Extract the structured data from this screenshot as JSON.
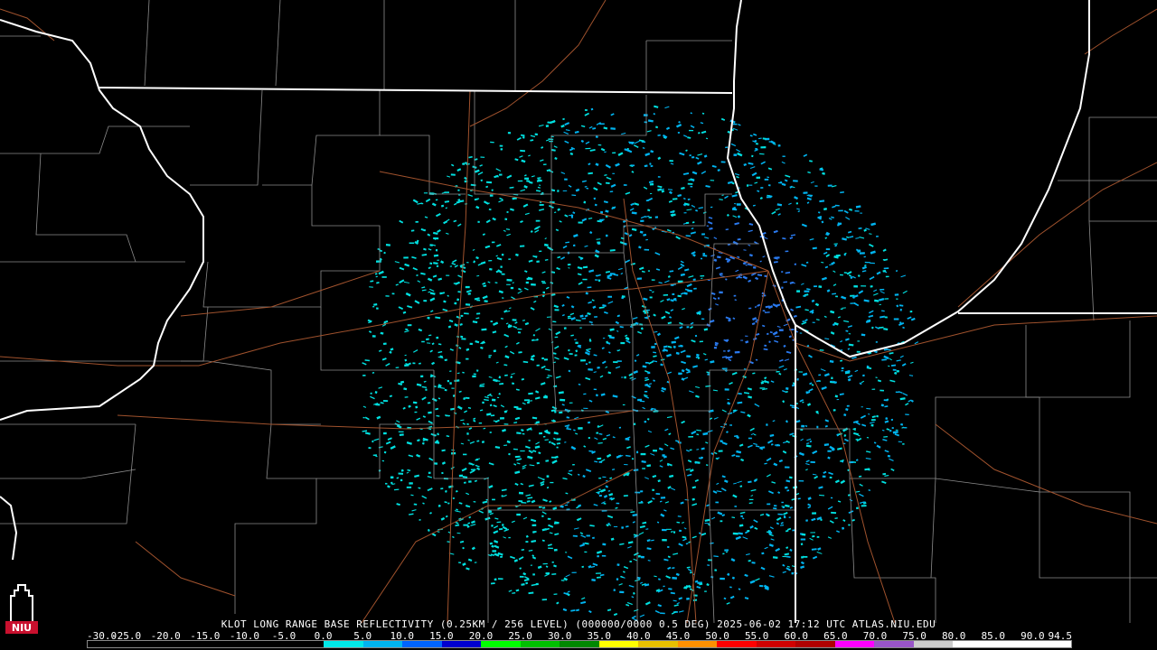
{
  "caption": {
    "product": "KLOT LONG RANGE BASE REFLECTIVITY (0.25KM / 256 LEVEL) (000000/0000 0.5 DEG) 2025-06-02 17:12 UTC  ATLAS.NIU.EDU"
  },
  "color_scale": {
    "labels": [
      "-30.0",
      "-25.0",
      "-20.0",
      "-15.0",
      "-10.0",
      "-5.0",
      "0.0",
      "5.0",
      "10.0",
      "15.0",
      "20.0",
      "25.0",
      "30.0",
      "35.0",
      "40.0",
      "45.0",
      "50.0",
      "55.0",
      "60.0",
      "65.0",
      "70.0",
      "75.0",
      "80.0",
      "85.0",
      "90.0",
      "94.5"
    ],
    "colors": [
      "#000000",
      "#000000",
      "#000000",
      "#000000",
      "#000000",
      "#000000",
      "#00e8e8",
      "#00b4f0",
      "#0064ff",
      "#0000d0",
      "#00ff00",
      "#00c000",
      "#008800",
      "#ffff00",
      "#e8c000",
      "#ff9000",
      "#ff0000",
      "#d00000",
      "#b00000",
      "#ff00ff",
      "#9955c9",
      "#cccccc",
      "#ffffff",
      "#ffffff",
      "#ffffff"
    ]
  },
  "logo": {
    "text": "NIU",
    "color": "#c8102e"
  },
  "map": {
    "background": "#000000",
    "state_border_color": "#ffffff",
    "county_color": "#8c8c8c",
    "highway_color": "#a0522d",
    "echo_colors": [
      "#00e0e0",
      "#00b4f0",
      "#2a7af0"
    ]
  }
}
